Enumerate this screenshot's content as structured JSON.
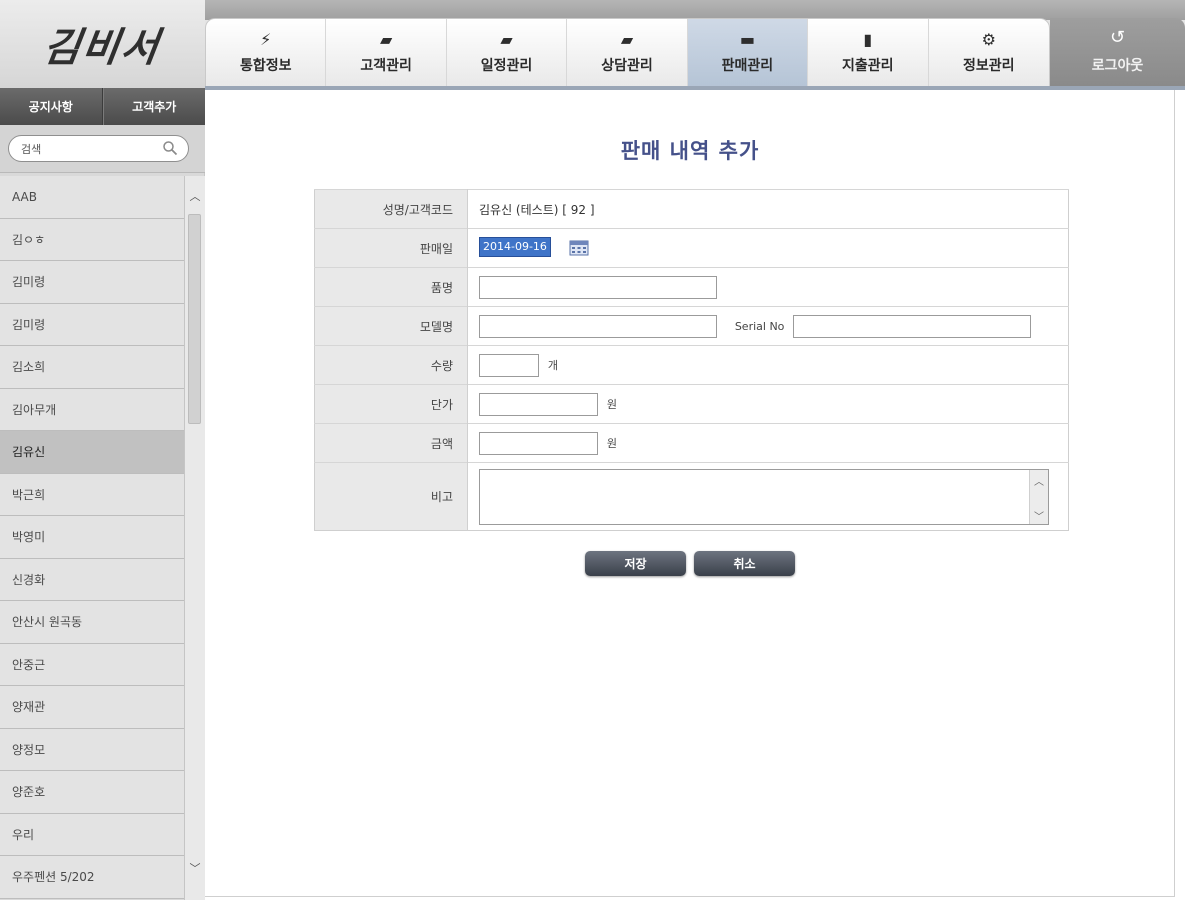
{
  "logo": {
    "text": "김비서"
  },
  "side_menu": {
    "notice": "공지사항",
    "add_customer": "고객추가"
  },
  "search": {
    "placeholder": "검색"
  },
  "customers": [
    {
      "name": "AAB",
      "selected": false
    },
    {
      "name": "김ㅇㅎ",
      "selected": false
    },
    {
      "name": "김미령",
      "selected": false
    },
    {
      "name": "김미령",
      "selected": false
    },
    {
      "name": "김소희",
      "selected": false
    },
    {
      "name": "김아무개",
      "selected": false
    },
    {
      "name": "김유신",
      "selected": true
    },
    {
      "name": "박근희",
      "selected": false
    },
    {
      "name": "박영미",
      "selected": false
    },
    {
      "name": "신경화",
      "selected": false
    },
    {
      "name": "안산시 원곡동",
      "selected": false
    },
    {
      "name": "안중근",
      "selected": false
    },
    {
      "name": "양재관",
      "selected": false
    },
    {
      "name": "양정모",
      "selected": false
    },
    {
      "name": "양준호",
      "selected": false
    },
    {
      "name": "우리",
      "selected": false
    },
    {
      "name": "우주펜션 5/202",
      "selected": false
    }
  ],
  "tabs": [
    {
      "label": "통합정보",
      "icon": "lightning-icon",
      "active": false
    },
    {
      "label": "고객관리",
      "icon": "customer-folder-icon",
      "active": false
    },
    {
      "label": "일정관리",
      "icon": "schedule-folder-icon",
      "active": false
    },
    {
      "label": "상담관리",
      "icon": "consult-folder-icon",
      "active": false
    },
    {
      "label": "판매관리",
      "icon": "briefcase-icon",
      "active": true
    },
    {
      "label": "지출관리",
      "icon": "document-icon",
      "active": false
    },
    {
      "label": "정보관리",
      "icon": "gear-icon",
      "active": false
    }
  ],
  "logout": {
    "label": "로그아웃",
    "icon": "logout-arrow-icon"
  },
  "page": {
    "title": "판매 내역 추가"
  },
  "form": {
    "customer_label": "성명/고객코드",
    "customer_value": "김유신 (테스트)  [ 92 ]",
    "date_label": "판매일",
    "date_value": "2014-09-16",
    "product_label": "품명",
    "product_value": "",
    "model_label": "모델명",
    "model_value": "",
    "serial_label": "Serial No",
    "serial_value": "",
    "qty_label": "수량",
    "qty_value": "",
    "qty_unit": "개",
    "price_label": "단가",
    "price_value": "",
    "price_unit": "원",
    "amount_label": "금액",
    "amount_value": "",
    "amount_unit": "원",
    "memo_label": "비고",
    "memo_value": ""
  },
  "buttons": {
    "save": "저장",
    "cancel": "취소"
  },
  "colors": {
    "title": "#45518a",
    "active_tab": "#b5c4d6",
    "button": "#3a404a",
    "date_highlight": "#3f74c8"
  }
}
